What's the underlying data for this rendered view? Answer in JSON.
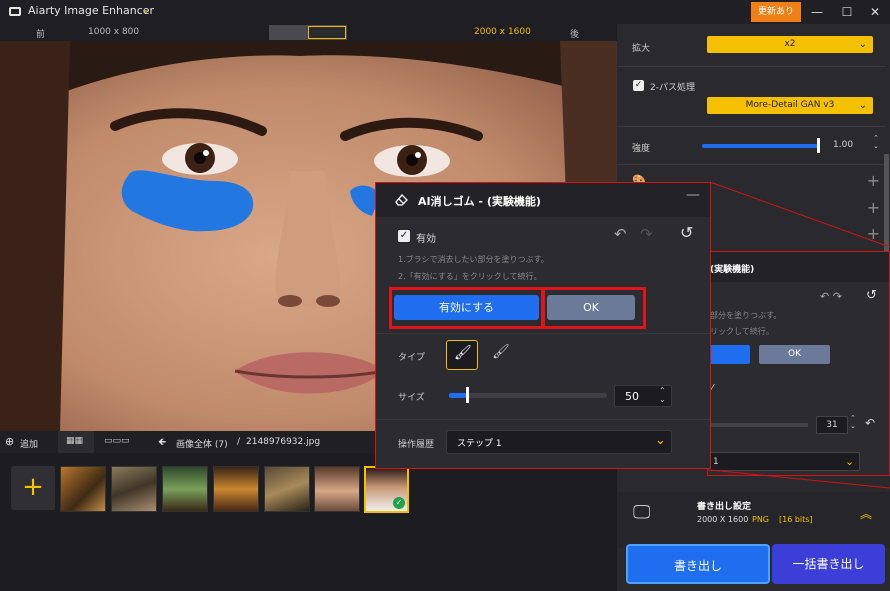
{
  "titlebar": {
    "app_title": "Aiarty Image Enhancer",
    "update_label": "更新あり",
    "min": "—",
    "max": "☐",
    "close": "✕"
  },
  "subbar": {
    "before": "前",
    "before_res": "1000 x 800",
    "after_res": "2000 x 1600",
    "after": "後"
  },
  "bottombar": {
    "add": "追加",
    "breadcrumb_all": "画像全体 (7)",
    "sep": "/",
    "filename": "2148976932.jpg"
  },
  "right": {
    "scale_label": "拡大",
    "scale_value": "x2",
    "twopass_label": "2-パス処理",
    "model_value": "More-Detail GAN  v3",
    "strength_label": "強度",
    "strength_value": "1.00",
    "bg_title": "(実験機能)",
    "bg_hint1": "部分を塗りつぶす。",
    "bg_hint2": "リックして続行。",
    "bg_ok": "OK",
    "bg_size": "31",
    "bg_step": "1",
    "export_title": "書き出し設定",
    "export_res": "2000 X 1600",
    "export_fmt": "PNG",
    "export_bits": "[16 bits]",
    "export_btn": "書き出し",
    "batch_btn": "一括書き出し"
  },
  "dialog": {
    "title": "AI消しゴム - (実験機能)",
    "enable_label": "有効",
    "hint1": "1.ブラシで消去したい部分を塗りつぶす。",
    "hint2": "2.「有効にする」をクリックして続行。",
    "apply_btn": "有効にする",
    "ok_btn": "OK",
    "type_label": "タイプ",
    "size_label": "サイズ",
    "size_value": "50",
    "history_label": "操作履歴",
    "history_value": "ステップ 1"
  },
  "colors": {
    "accent": "#f5c000",
    "blue": "#1f6ef0",
    "highlight": "#e0141a"
  }
}
